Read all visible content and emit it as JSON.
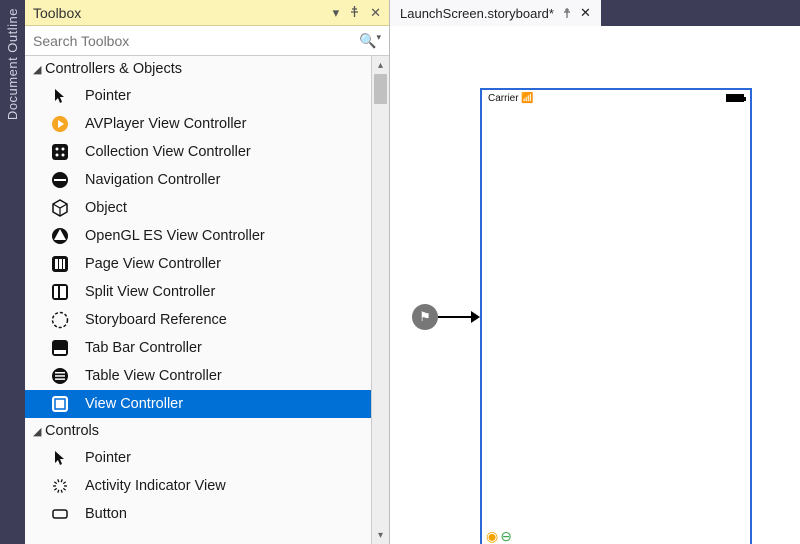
{
  "dock": {
    "label": "Document Outline"
  },
  "toolbox": {
    "title": "Toolbox",
    "search_placeholder": "Search Toolbox",
    "groups": [
      {
        "label": "Controllers & Objects",
        "expanded": true,
        "items": [
          {
            "icon": "pointer",
            "label": "Pointer",
            "selected": false
          },
          {
            "icon": "avplayer",
            "label": "AVPlayer View Controller",
            "selected": false
          },
          {
            "icon": "collection",
            "label": "Collection View Controller",
            "selected": false
          },
          {
            "icon": "navigation",
            "label": "Navigation Controller",
            "selected": false
          },
          {
            "icon": "object",
            "label": "Object",
            "selected": false
          },
          {
            "icon": "opengl",
            "label": "OpenGL ES View Controller",
            "selected": false
          },
          {
            "icon": "pageview",
            "label": "Page View Controller",
            "selected": false
          },
          {
            "icon": "splitview",
            "label": "Split View Controller",
            "selected": false
          },
          {
            "icon": "storyref",
            "label": "Storyboard Reference",
            "selected": false
          },
          {
            "icon": "tabbar",
            "label": "Tab Bar Controller",
            "selected": false
          },
          {
            "icon": "tableview",
            "label": "Table View Controller",
            "selected": false
          },
          {
            "icon": "viewctrl",
            "label": "View Controller",
            "selected": true
          }
        ]
      },
      {
        "label": "Controls",
        "expanded": true,
        "items": [
          {
            "icon": "pointer",
            "label": "Pointer",
            "selected": false
          },
          {
            "icon": "activity",
            "label": "Activity Indicator View",
            "selected": false
          },
          {
            "icon": "button",
            "label": "Button",
            "selected": false
          }
        ]
      }
    ]
  },
  "designer": {
    "tab_label": "LaunchScreen.storyboard*",
    "status_carrier": "Carrier"
  }
}
